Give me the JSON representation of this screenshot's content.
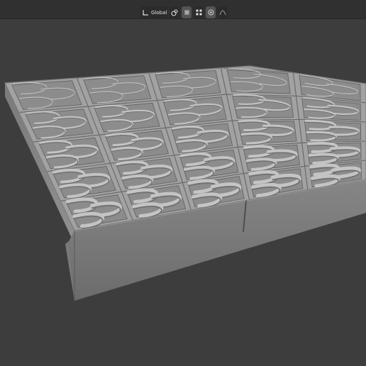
{
  "header": {
    "transform_orientation": "Global",
    "icons": [
      "transform-orientation-icon",
      "pivot-point-icon",
      "snap-icon",
      "snap-increment-icon",
      "proportional-editing-icon",
      "falloff-icon"
    ]
  },
  "viewport": {
    "background_color": "#3d3d3d",
    "object": "relief-tile-slab"
  }
}
